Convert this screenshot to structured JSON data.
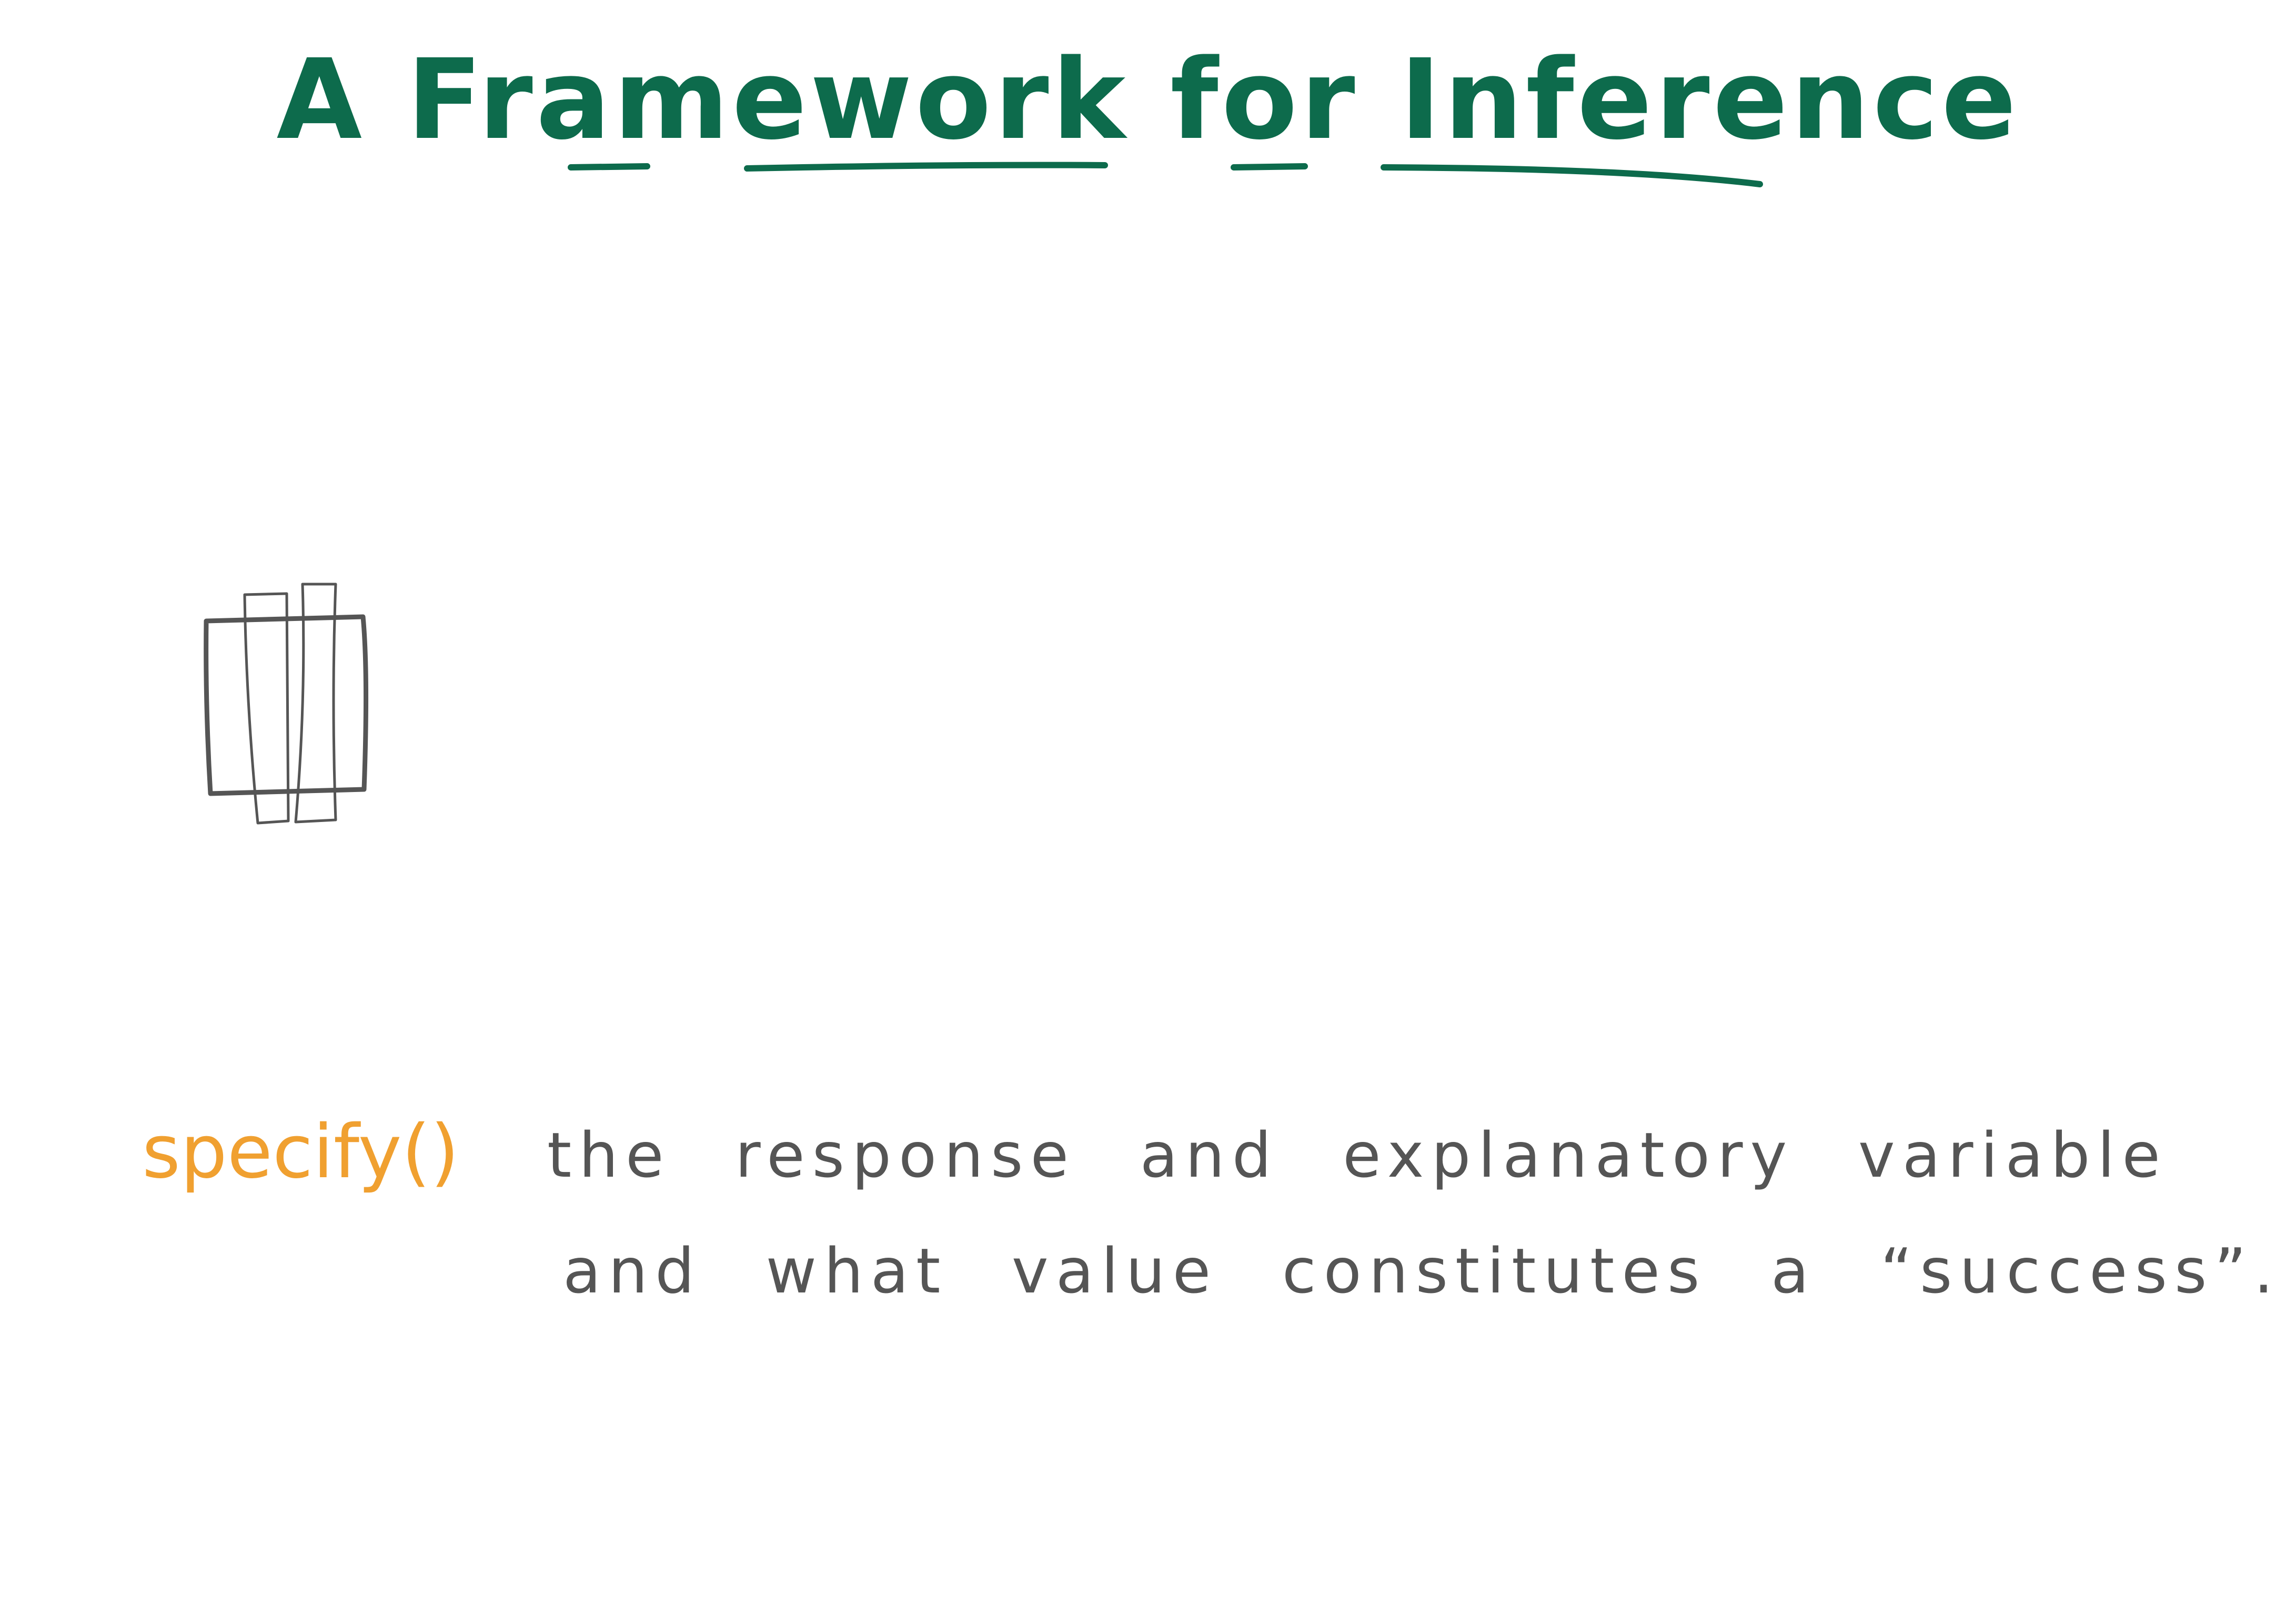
{
  "title": "A Framework for Inference",
  "verb": "specify()",
  "description": {
    "line1": "the response and explanatory variable",
    "line2": "and what value constitutes a “success”."
  },
  "colors": {
    "title": "#0d6b4c",
    "verb": "#f0a030",
    "text": "#555555",
    "drawing": "#555555",
    "background": "#ffffff"
  },
  "icons": {
    "data-table": "table-sketch-icon"
  }
}
